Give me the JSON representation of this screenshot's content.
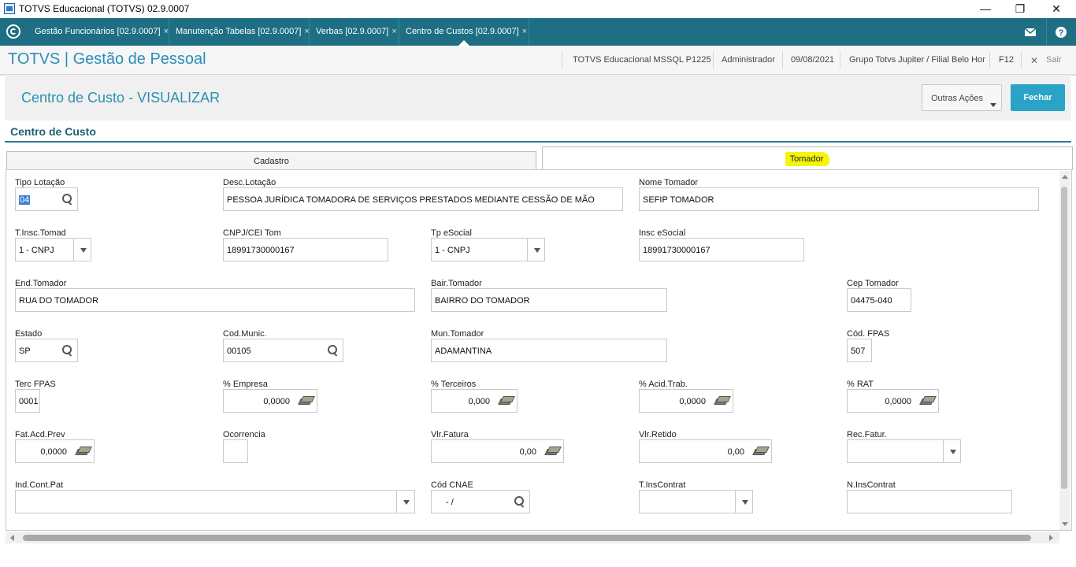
{
  "window": {
    "title": "TOTVS Educacional (TOTVS) 02.9.0007",
    "minimize": "—",
    "maximize": "❐",
    "close": "✕"
  },
  "tabs": [
    {
      "label": "Gestão Funcionários [02.9.0007]"
    },
    {
      "label": "Manutenção Tabelas [02.9.0007]"
    },
    {
      "label": "Verbas [02.9.0007]"
    },
    {
      "label": "Centro de Custos [02.9.0007]"
    }
  ],
  "tab_close": "×",
  "header": {
    "app_title": "TOTVS | Gestão de Pessoal",
    "environment": "TOTVS Educacional MSSQL P1225",
    "user": "Administrador",
    "date": "09/08/2021",
    "branch": "Grupo Totvs Jupiter / Filial Belo Hor",
    "shortcut": "F12",
    "exit_icon": "✕",
    "exit": "Sair"
  },
  "page": {
    "title": "Centro de Custo - VISUALIZAR",
    "actions_button": "Outras Ações",
    "close_button": "Fechar",
    "section_title": "Centro de Custo",
    "folder_tabs": [
      "Cadastro",
      "Tomador"
    ]
  },
  "fields": {
    "tipo_lotacao": {
      "label": "Tipo Lotação",
      "value": "04"
    },
    "desc_lotacao": {
      "label": "Desc.Lotação",
      "value": "PESSOA JURÍDICA TOMADORA DE SERVIÇOS PRESTADOS MEDIANTE CESSÃO DE MÃO"
    },
    "nome_tomador": {
      "label": "Nome Tomador",
      "value": "SEFIP TOMADOR"
    },
    "t_insc_tomad": {
      "label": "T.Insc.Tomad",
      "value": "1 - CNPJ"
    },
    "cnpj_cei_tom": {
      "label": "CNPJ/CEI Tom",
      "value": "18991730000167"
    },
    "tp_esocial": {
      "label": "Tp eSocial",
      "value": "1 - CNPJ"
    },
    "insc_esocial": {
      "label": "Insc eSocial",
      "value": "18991730000167"
    },
    "end_tomador": {
      "label": "End.Tomador",
      "value": "RUA DO TOMADOR"
    },
    "bair_tomador": {
      "label": "Bair.Tomador",
      "value": "BAIRRO DO TOMADOR"
    },
    "cep_tomador": {
      "label": "Cep Tomador",
      "value": "04475-040"
    },
    "estado": {
      "label": "Estado",
      "value": "SP"
    },
    "cod_munic": {
      "label": "Cod.Munic.",
      "value": "00105"
    },
    "mun_tomador": {
      "label": "Mun.Tomador",
      "value": "ADAMANTINA"
    },
    "cod_fpas": {
      "label": "Cód. FPAS",
      "value": "507"
    },
    "terc_fpas": {
      "label": "Terc FPAS",
      "value": "0001"
    },
    "pct_empresa": {
      "label": "% Empresa",
      "value": "0,0000"
    },
    "pct_terceiros": {
      "label": "% Terceiros",
      "value": "0,000"
    },
    "pct_acid_trab": {
      "label": "% Acid.Trab.",
      "value": "0,0000"
    },
    "pct_rat": {
      "label": "% RAT",
      "value": "0,0000"
    },
    "fat_acd_prev": {
      "label": "Fat.Acd.Prev",
      "value": "0,0000"
    },
    "ocorrencia": {
      "label": "Ocorrencia",
      "value": ""
    },
    "vlr_fatura": {
      "label": "Vlr.Fatura",
      "value": "0,00"
    },
    "vlr_retido": {
      "label": "Vlr.Retido",
      "value": "0,00"
    },
    "rec_fatur": {
      "label": "Rec.Fatur.",
      "value": ""
    },
    "ind_cont_pat": {
      "label": "Ind.Cont.Pat",
      "value": ""
    },
    "cod_cnae": {
      "label": "Cód CNAE",
      "value": "- /"
    },
    "t_inscontrat": {
      "label": "T.InsContrat",
      "value": ""
    },
    "n_inscontrat": {
      "label": "N.InsContrat",
      "value": ""
    }
  },
  "icons": {
    "search": "search-icon",
    "calculator": "calculator-icon",
    "dropdown": "chevron-down-icon"
  },
  "colors": {
    "tabbar": "#1e6e84",
    "accent": "#2a90b4",
    "primary_button": "#2aa3c6",
    "highlight": "#f6f50b"
  }
}
